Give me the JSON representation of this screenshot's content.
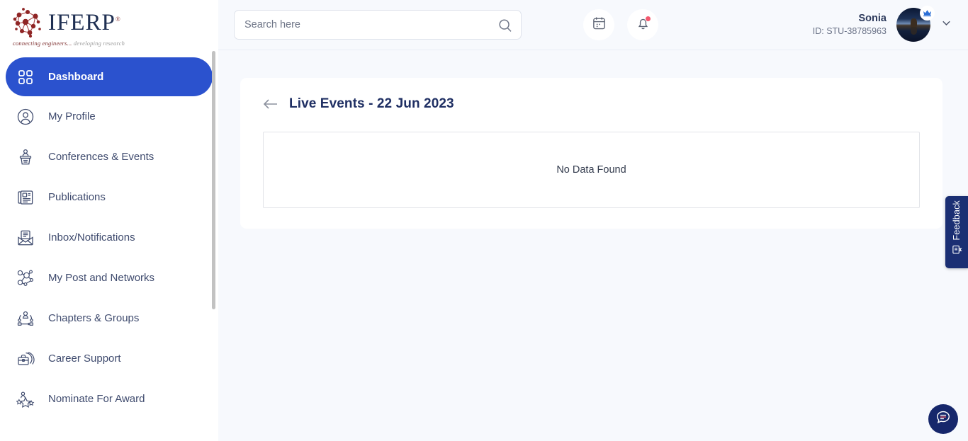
{
  "brand": {
    "name": "IFERP",
    "registered": "®",
    "tagline_italic": "connecting engineers...",
    "tagline_grey": "developing research",
    "logo_icon": "molecule-network-icon"
  },
  "sidebar": {
    "items": [
      {
        "label": "Dashboard",
        "icon": "grid-dashboard-icon",
        "active": true
      },
      {
        "label": "My Profile",
        "icon": "user-circle-icon",
        "active": false
      },
      {
        "label": "Conferences & Events",
        "icon": "podium-speaker-icon",
        "active": false
      },
      {
        "label": "Publications",
        "icon": "newspaper-icon",
        "active": false
      },
      {
        "label": "Inbox/Notifications",
        "icon": "envelope-open-icon",
        "active": false
      },
      {
        "label": "My Post and Networks",
        "icon": "network-nodes-icon",
        "active": false
      },
      {
        "label": "Chapters & Groups",
        "icon": "group-hierarchy-icon",
        "active": false
      },
      {
        "label": "Career Support",
        "icon": "briefcase-icon",
        "active": false
      },
      {
        "label": "Nominate For Award",
        "icon": "stars-award-icon",
        "active": false
      }
    ],
    "scrollbar": {
      "visible": true
    }
  },
  "topbar": {
    "search": {
      "placeholder": "Search here",
      "value": "",
      "icon": "search-icon"
    },
    "calendar_icon": "calendar-icon",
    "notification_icon": "bell-icon",
    "notification_has_badge": true,
    "profile": {
      "name": "Sonia",
      "id": "ID: STU-38785963",
      "avatar_icon": "user-avatar-photo",
      "crown_icon": "crown-badge-icon",
      "chevron_icon": "chevron-down-icon"
    }
  },
  "content": {
    "back_icon": "arrow-left-icon",
    "title": "Live Events - 22 Jun 2023",
    "empty_message": "No Data Found"
  },
  "floating": {
    "feedback_label": "Feedback",
    "feedback_icon": "feedback-form-icon",
    "chat_icon": "chat-bubble-icon"
  },
  "colors": {
    "accent_blue": "#2B52CE",
    "deep_navy": "#1b2f73",
    "page_bg": "#f7f9fd",
    "text_navy": "#3f4b6e",
    "badge_red": "#f4586e"
  }
}
